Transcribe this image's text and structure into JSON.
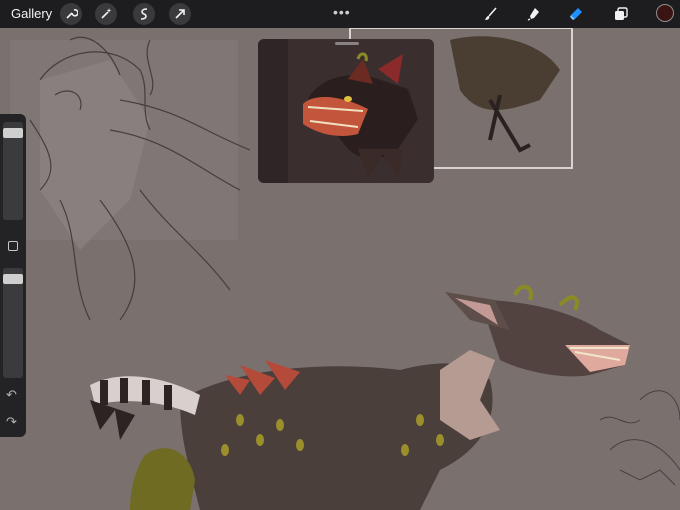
{
  "toolbar": {
    "gallery_label": "Gallery",
    "left_icons": [
      "wrench-icon",
      "magic-wand-icon",
      "selection-icon",
      "transform-arrow-icon"
    ],
    "more_glyph": "•••",
    "right_icons": [
      "brush-icon",
      "smudge-icon",
      "eraser-icon",
      "layers-icon"
    ],
    "active_tool": "eraser-icon",
    "current_color": "#3a1412",
    "accent_color": "#1e90ff"
  },
  "sidebar": {
    "size_slider_value": 0.9,
    "opacity_slider_value": 0.95,
    "undo_glyph": "↶",
    "redo_glyph": "↷"
  },
  "reference_window": {
    "visible": true
  }
}
